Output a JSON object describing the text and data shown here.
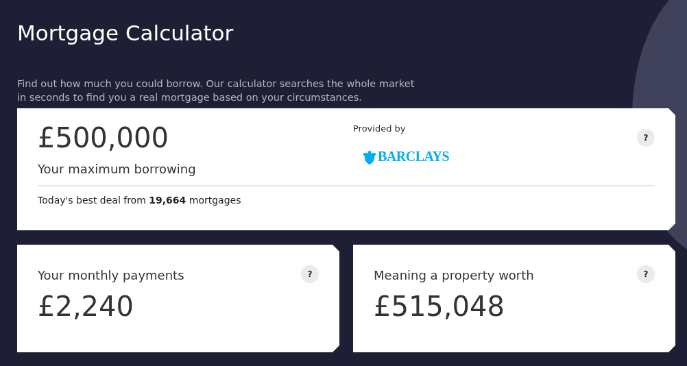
{
  "title": "Mortgage Calculator",
  "intro": "Find out how much you could borrow. Our calculator searches the whole market in seconds to find you a real mortgage based on your circumstances.",
  "summary": {
    "amount": "£500,000",
    "label": "Your maximum borrowing",
    "provided_by": "Provided by",
    "provider": "BARCLAYS",
    "help": "?",
    "deal": "Today's best deal from **19,664** mortgages"
  },
  "cards": [
    {
      "label": "Your monthly payments",
      "value": "£2,240",
      "help": "?"
    },
    {
      "label": "Meaning a property worth",
      "value": "£515,048",
      "help": "?"
    }
  ]
}
